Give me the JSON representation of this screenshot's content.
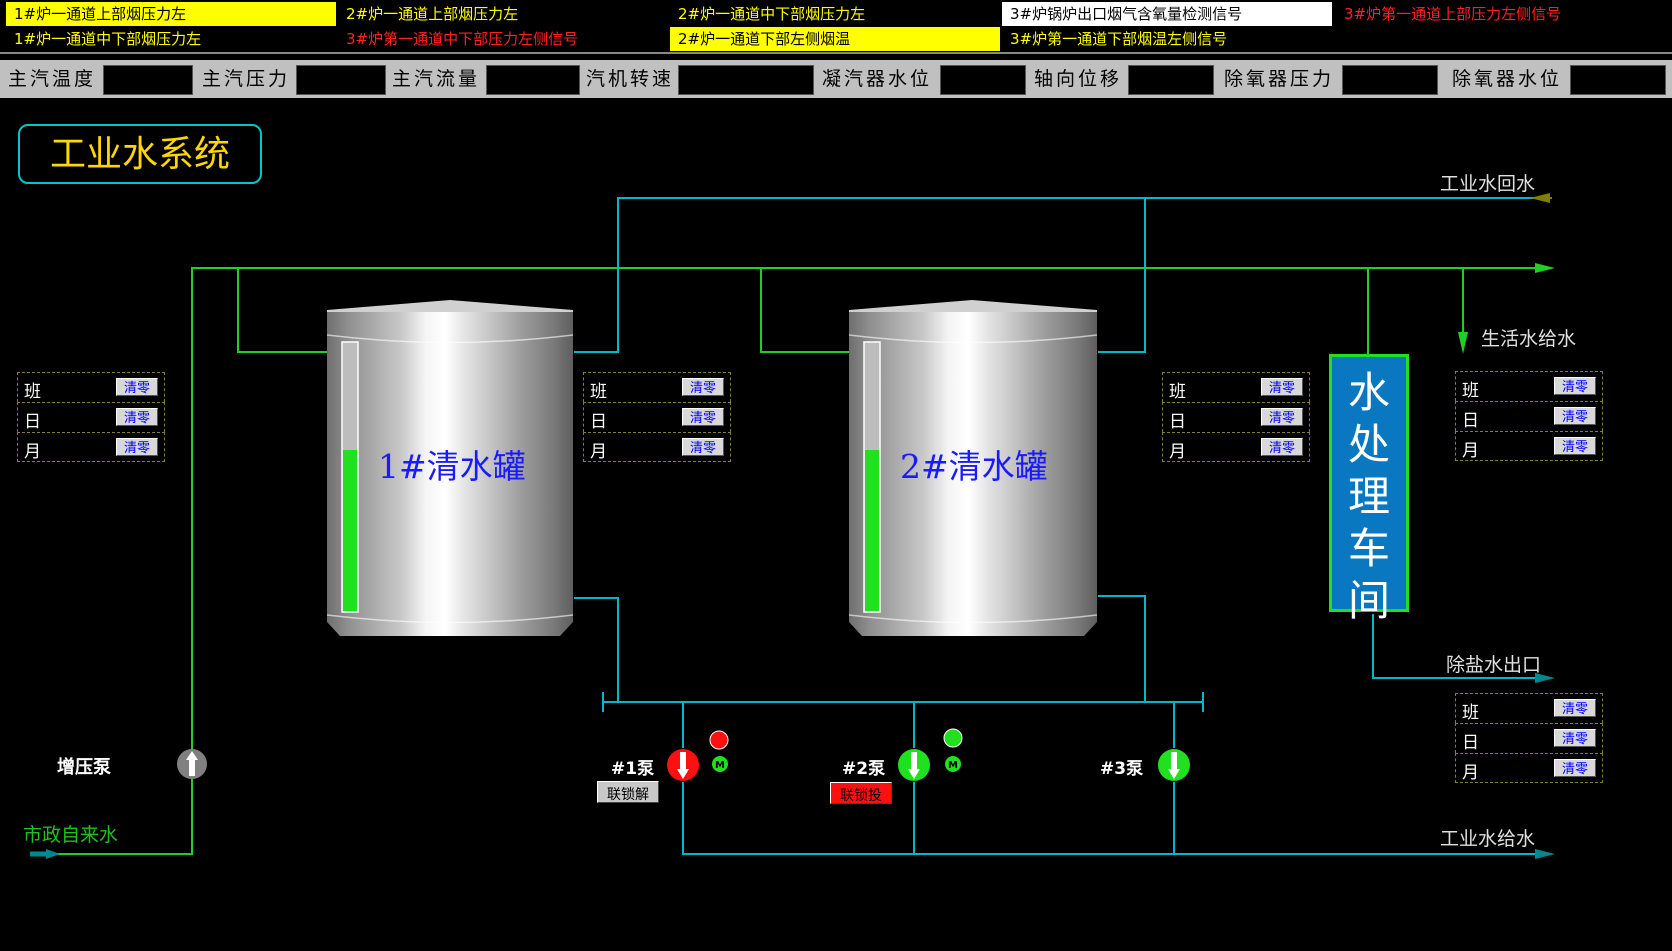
{
  "alarms": [
    {
      "text": "1#炉一通道上部烟压力左",
      "style": "yellow-bg"
    },
    {
      "text": "2#炉一通道上部烟压力左",
      "style": "t-yellow"
    },
    {
      "text": "2#炉一通道中下部烟压力左",
      "style": "t-yellow"
    },
    {
      "text": "3#炉锅炉出口烟气含氧量检测信号",
      "style": "white-bg"
    },
    {
      "text": "3#炉第一通道上部压力左侧信号",
      "style": "t-red"
    },
    {
      "text": "1#炉一通道中下部烟压力左",
      "style": "t-yellow"
    },
    {
      "text": "3#炉第一通道中下部压力左侧信号",
      "style": "t-red"
    },
    {
      "text": "2#炉一通道下部左侧烟温",
      "style": "yellow-bg"
    },
    {
      "text": "3#炉第一通道下部烟温左侧信号",
      "style": "t-yellow"
    }
  ],
  "params": [
    "主汽温度",
    "主汽压力",
    "主汽流量",
    "汽机转速",
    "凝汽器水位",
    "轴向位移",
    "除氧器压力",
    "除氧器水位"
  ],
  "title": "工业水系统",
  "tanks": [
    {
      "name": "1#清水罐",
      "level": 0.6
    },
    {
      "name": "2#清水罐",
      "level": 0.6
    }
  ],
  "water_treatment": "水处理车间",
  "counters": {
    "shift": "班",
    "day": "日",
    "month": "月",
    "reset": "清零"
  },
  "labels": {
    "return_water": "工业水回水",
    "domestic_supply": "生活水给水",
    "demin_outlet": "除盐水出口",
    "industrial_supply": "工业水给水",
    "booster_pump": "增压泵",
    "municipal_water": "市政自来水"
  },
  "pumps": [
    {
      "label": "#1泵",
      "status": "red",
      "interlock": "联锁解除",
      "interlock_color": "#c8c8c8"
    },
    {
      "label": "#2泵",
      "status": "green",
      "interlock": "联锁投入",
      "interlock_color": "#ff1010"
    },
    {
      "label": "#3泵",
      "status": "green"
    }
  ],
  "colors": {
    "pipe_green": "#20d020",
    "pipe_cyan": "#00b8c8",
    "arrow_green": "#20d020",
    "arrow_olive": "#808000",
    "arrow_teal": "#008890"
  }
}
